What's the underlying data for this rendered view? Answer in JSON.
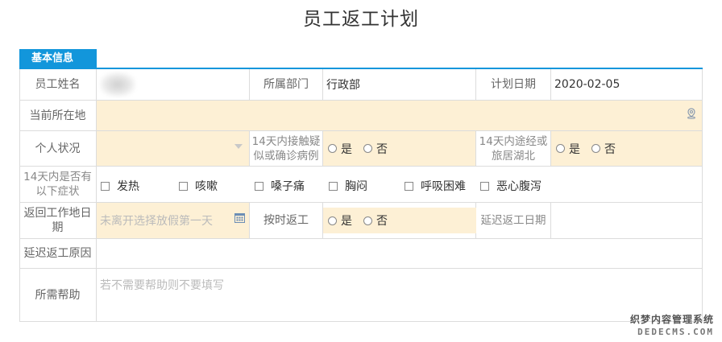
{
  "page": {
    "title": "员工返工计划"
  },
  "section": {
    "title": "基本信息"
  },
  "form": {
    "employee_name": {
      "label": "员工姓名"
    },
    "department": {
      "label": "所属部门",
      "value": "行政部"
    },
    "plan_date": {
      "label": "计划日期",
      "value": "2020-02-05"
    },
    "current_location": {
      "label": "当前所在地",
      "value": ""
    },
    "personal_status": {
      "label": "个人状况",
      "value": ""
    },
    "contact_case": {
      "label": "14天内接触疑似或确诊病例",
      "options": [
        "是",
        "否"
      ]
    },
    "hubei_travel": {
      "label": "14天内途经或旅居湖北",
      "options": [
        "是",
        "否"
      ]
    },
    "symptoms": {
      "label": "14天内是否有以下症状",
      "options": [
        "发热",
        "咳嗽",
        "嗓子痛",
        "胸闷",
        "呼吸困难",
        "恶心腹泻"
      ]
    },
    "return_work_date": {
      "label": "返回工作地日期",
      "placeholder": "未离开选择放假第一天"
    },
    "on_time_return": {
      "label": "按时返工",
      "options": [
        "是",
        "否"
      ]
    },
    "delay_date": {
      "label": "延迟返工日期",
      "value": ""
    },
    "delay_reason": {
      "label": "延迟返工原因",
      "value": ""
    },
    "help_needed": {
      "label": "所需帮助",
      "placeholder": "若不需要帮助则不要填写"
    }
  },
  "icons": {
    "location": "map-pin-icon",
    "dropdown": "chevron-down-icon",
    "calendar": "calendar-icon"
  },
  "watermark": {
    "line1": "织梦内容管理系统",
    "line2": "DEDECMS.COM"
  },
  "colors": {
    "accent": "#1296db",
    "field_highlight": "#fdf0d5",
    "border": "#dcdcdc"
  }
}
